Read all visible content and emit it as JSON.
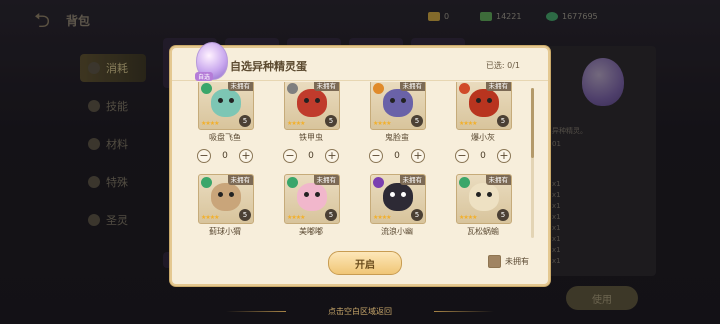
{
  "header": {
    "title": "背包",
    "resources": [
      {
        "icon": "gold-coin-icon",
        "value": "0",
        "color": "#c9a443"
      },
      {
        "icon": "cash-icon",
        "value": "14221",
        "color": "#5ea65a"
      },
      {
        "icon": "green-gem-icon",
        "value": "1677695",
        "color": "#46a36a"
      }
    ]
  },
  "sidebar": {
    "items": [
      {
        "label": "消耗",
        "active": true
      },
      {
        "label": "技能",
        "active": false
      },
      {
        "label": "材料",
        "active": false
      },
      {
        "label": "特殊",
        "active": false
      },
      {
        "label": "圣灵",
        "active": false
      }
    ]
  },
  "right_panel": {
    "lines": [
      "异种精灵。",
      "01"
    ],
    "counts": [
      "x1",
      "x1",
      "x1",
      "x1",
      "x1",
      "x1",
      "x1",
      "x1"
    ]
  },
  "use_button": "使用",
  "bottom_hint": "点击空白区域返回",
  "dialog": {
    "badge": "自选",
    "title": "自选异种精灵蛋",
    "selected_label": "已选:",
    "selected_value": "0/1",
    "own_tag": "未拥有",
    "open_button": "开启",
    "filter_label": "未拥有",
    "items": [
      {
        "name": "吸盘飞鱼",
        "count": "5",
        "qty": "0",
        "stars": "★★★★",
        "type_color": "#3aa66a",
        "sprite_color": "#7dc6b4"
      },
      {
        "name": "铁甲虫",
        "count": "5",
        "qty": "0",
        "stars": "★★★★",
        "type_color": "#7f7f7f",
        "sprite_color": "#c03b2c"
      },
      {
        "name": "鬼脸蛮",
        "count": "5",
        "qty": "0",
        "stars": "★★★★",
        "type_color": "#e08a2a",
        "sprite_color": "#6a62a8"
      },
      {
        "name": "爆小灰",
        "count": "5",
        "qty": "0",
        "stars": "★★★★",
        "type_color": "#d04a2a",
        "sprite_color": "#b8341f"
      },
      {
        "name": "蓟球小猬",
        "count": "5",
        "qty": null,
        "stars": "★★★★",
        "type_color": "#3aa66a",
        "sprite_color": "#c9a57a"
      },
      {
        "name": "美嘟嘟",
        "count": "5",
        "qty": null,
        "stars": "★★★★",
        "type_color": "#3aa66a",
        "sprite_color": "#f1b7cc"
      },
      {
        "name": "流浪小幽",
        "count": "5",
        "qty": null,
        "stars": "★★★★",
        "type_color": "#7a3fb0",
        "sprite_color": "#2d2a35"
      },
      {
        "name": "瓦松蜗蝓",
        "count": "5",
        "qty": null,
        "stars": "★★★★",
        "type_color": "#3aa66a",
        "sprite_color": "#eee1c3"
      }
    ]
  }
}
